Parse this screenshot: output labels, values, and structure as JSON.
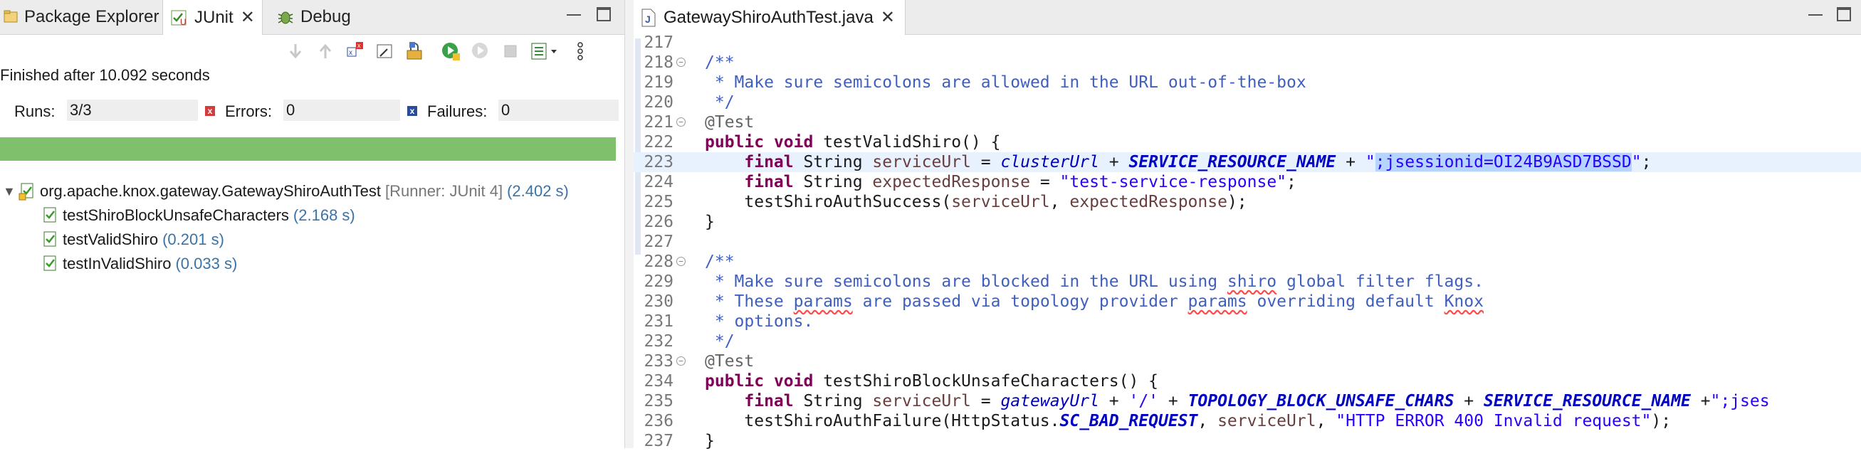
{
  "left_panel": {
    "tabs": [
      {
        "label": "Package Explorer",
        "icon": "package-explorer-icon"
      },
      {
        "label": "JUnit",
        "icon": "junit-icon",
        "active": true
      },
      {
        "label": "Debug",
        "icon": "debug-bug-icon"
      }
    ],
    "close_glyph": "✕",
    "status": "Finished after 10.092 seconds",
    "counters": {
      "runs_label": "Runs:",
      "runs_value": "3/3",
      "errors_label": "Errors:",
      "errors_value": "0",
      "failures_label": "Failures:",
      "failures_value": "0"
    },
    "progress": {
      "fraction": 1.0,
      "color": "#7ec06c"
    },
    "tree": {
      "suite": {
        "name": "org.apache.knox.gateway.GatewayShiroAuthTest",
        "runner": "[Runner: JUnit 4]",
        "time": "(2.402 s)"
      },
      "tests": [
        {
          "name": "testShiroBlockUnsafeCharacters",
          "time": "(2.168 s)"
        },
        {
          "name": "testValidShiro",
          "time": "(0.201 s)"
        },
        {
          "name": "testInValidShiro",
          "time": "(0.033 s)"
        }
      ]
    }
  },
  "editor": {
    "tab": {
      "file": "GatewayShiroAuthTest.java",
      "icon": "java-file-icon"
    },
    "lines": [
      {
        "n": "217"
      },
      {
        "n": "218",
        "fold": true,
        "parts": [
          [
            "jd",
            "/**"
          ]
        ]
      },
      {
        "n": "219",
        "parts": [
          [
            "jd",
            " * Make sure semicolons are allowed in the URL out-of-the-box"
          ]
        ]
      },
      {
        "n": "220",
        "parts": [
          [
            "jd",
            " */"
          ]
        ]
      },
      {
        "n": "221",
        "fold": true,
        "parts": [
          [
            "ann",
            "@Test"
          ]
        ]
      },
      {
        "n": "222",
        "parts": [
          [
            "kw",
            "public"
          ],
          [
            "",
            " "
          ],
          [
            "kw",
            "void"
          ],
          [
            "",
            " testValidShiro() {"
          ]
        ]
      },
      {
        "n": "223",
        "highlight": true,
        "parts": [
          [
            "",
            "    "
          ],
          [
            "kw",
            "final"
          ],
          [
            "",
            " String "
          ],
          [
            "var",
            "serviceUrl"
          ],
          [
            "",
            " = "
          ],
          [
            "fld",
            "clusterUrl"
          ],
          [
            "",
            " + "
          ],
          [
            "cst",
            "SERVICE_RESOURCE_NAME"
          ],
          [
            "",
            " + "
          ],
          [
            "str",
            "\""
          ],
          [
            "str sel",
            ";jsessionid=OI24B9ASD7BSSD"
          ],
          [
            "str",
            "\""
          ],
          [
            "",
            ";"
          ]
        ]
      },
      {
        "n": "224",
        "parts": [
          [
            "",
            "    "
          ],
          [
            "kw",
            "final"
          ],
          [
            "",
            " String "
          ],
          [
            "var",
            "expectedResponse"
          ],
          [
            "",
            " = "
          ],
          [
            "str",
            "\"test-service-response\""
          ],
          [
            "",
            ";"
          ]
        ]
      },
      {
        "n": "225",
        "parts": [
          [
            "",
            "    testShiroAuthSuccess("
          ],
          [
            "var",
            "serviceUrl"
          ],
          [
            "",
            ", "
          ],
          [
            "var",
            "expectedResponse"
          ],
          [
            "",
            ");"
          ]
        ]
      },
      {
        "n": "226",
        "parts": [
          [
            "",
            "}"
          ]
        ]
      },
      {
        "n": "227"
      },
      {
        "n": "228",
        "fold": true,
        "parts": [
          [
            "jd",
            "/**"
          ]
        ]
      },
      {
        "n": "229",
        "parts": [
          [
            "jd",
            " * Make sure semicolons are blocked in the URL using "
          ],
          [
            "jd squig",
            "shiro"
          ],
          [
            "jd",
            " global filter flags."
          ]
        ]
      },
      {
        "n": "230",
        "parts": [
          [
            "jd",
            " * These "
          ],
          [
            "jd squig",
            "params"
          ],
          [
            "jd",
            " are passed via topology provider "
          ],
          [
            "jd squig",
            "params"
          ],
          [
            "jd",
            " overriding default "
          ],
          [
            "jd squig",
            "Knox"
          ]
        ]
      },
      {
        "n": "231",
        "parts": [
          [
            "jd",
            " * options."
          ]
        ]
      },
      {
        "n": "232",
        "parts": [
          [
            "jd",
            " */"
          ]
        ]
      },
      {
        "n": "233",
        "fold": true,
        "parts": [
          [
            "ann",
            "@Test"
          ]
        ]
      },
      {
        "n": "234",
        "parts": [
          [
            "kw",
            "public"
          ],
          [
            "",
            " "
          ],
          [
            "kw",
            "void"
          ],
          [
            "",
            " testShiroBlockUnsafeCharacters() {"
          ]
        ]
      },
      {
        "n": "235",
        "parts": [
          [
            "",
            "    "
          ],
          [
            "kw",
            "final"
          ],
          [
            "",
            " String "
          ],
          [
            "var",
            "serviceUrl"
          ],
          [
            "",
            " = "
          ],
          [
            "fld",
            "gatewayUrl"
          ],
          [
            "",
            " + "
          ],
          [
            "str",
            "'/'"
          ],
          [
            "",
            " + "
          ],
          [
            "cst",
            "TOPOLOGY_BLOCK_UNSAFE_CHARS"
          ],
          [
            "",
            " + "
          ],
          [
            "cst",
            "SERVICE_RESOURCE_NAME"
          ],
          [
            "",
            " +"
          ],
          [
            "str",
            "\";jses"
          ]
        ]
      },
      {
        "n": "236",
        "parts": [
          [
            "",
            "    testShiroAuthFailure(HttpStatus."
          ],
          [
            "cst",
            "SC_BAD_REQUEST"
          ],
          [
            "",
            ", "
          ],
          [
            "var",
            "serviceUrl"
          ],
          [
            "",
            ", "
          ],
          [
            "str",
            "\"HTTP ERROR 400 Invalid request\""
          ],
          [
            "",
            ");"
          ]
        ]
      },
      {
        "n": "237",
        "parts": [
          [
            "",
            "}"
          ]
        ]
      }
    ]
  }
}
